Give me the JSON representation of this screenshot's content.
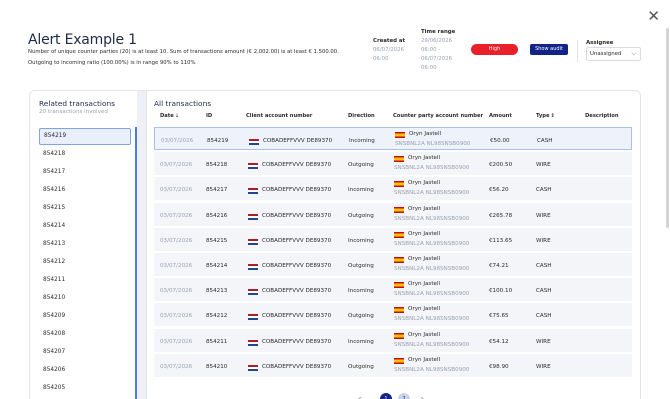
{
  "header": {
    "title": "Alert Example 1",
    "description_line1": "Number of unique counter parties (20) is at least 10. Sum of transactions amount (€ 2,002.00) is at least € 1.500.00.",
    "description_line2": "Outgoing to incoming ratio (100.00%) is in range 90% to 110%",
    "created_label": "Created at",
    "created_value": "06/07/2026 06:00",
    "range_label": "Time range",
    "range_value": "29/06/2026 06:00 - 06/07/2026 06:00",
    "severity": "High",
    "show_audit_label": "Show audit",
    "assignee_label": "Assignee",
    "assignee_value": "Unassigned"
  },
  "related": {
    "title": "Related transactions",
    "subtitle": "20 transactions involved",
    "items": [
      "854219",
      "854218",
      "854217",
      "854216",
      "854215",
      "854214",
      "854213",
      "854212",
      "854211",
      "854210",
      "854209",
      "854208",
      "854207",
      "854206",
      "854205"
    ]
  },
  "table": {
    "title": "All transactions",
    "columns": {
      "date": "Date",
      "id": "ID",
      "client": "Client account number",
      "direction": "Direction",
      "counterparty": "Counter party account number",
      "amount": "Amount",
      "type": "Type",
      "description": "Description"
    },
    "rows": [
      {
        "date": "03/07/2026",
        "id": "854219",
        "client": "COBADEFFVVV DE89370",
        "direction": "Incoming",
        "cp_name": "Oryn Jastell",
        "cp_acct": "SNSBNL2A NL98SNSB0900",
        "amount": "€50.00",
        "type": "CASH"
      },
      {
        "date": "03/07/2026",
        "id": "854218",
        "client": "COBADEFFVVV DE89370",
        "direction": "Outgoing",
        "cp_name": "Oryn Jastell",
        "cp_acct": "SNSBNL2A NL98SNSB0900",
        "amount": "€200.50",
        "type": "WIRE"
      },
      {
        "date": "03/07/2026",
        "id": "854217",
        "client": "COBADEFFVVV DE89370",
        "direction": "Incoming",
        "cp_name": "Oryn Jastell",
        "cp_acct": "SNSBNL2A NL98SNSB0900",
        "amount": "€56.20",
        "type": "CASH"
      },
      {
        "date": "03/07/2026",
        "id": "854216",
        "client": "COBADEFFVVV DE89370",
        "direction": "Outgoing",
        "cp_name": "Oryn Jastell",
        "cp_acct": "SNSBNL2A NL98SNSB0900",
        "amount": "€265.78",
        "type": "WIRE"
      },
      {
        "date": "03/07/2026",
        "id": "854215",
        "client": "COBADEFFVVV DE89370",
        "direction": "Incoming",
        "cp_name": "Oryn Jastell",
        "cp_acct": "SNSBNL2A NL98SNSB0900",
        "amount": "€113.65",
        "type": "WIRE"
      },
      {
        "date": "03/07/2026",
        "id": "854214",
        "client": "COBADEFFVVV DE89370",
        "direction": "Outgoing",
        "cp_name": "Oryn Jastell",
        "cp_acct": "SNSBNL2A NL98SNSB0900",
        "amount": "€74.21",
        "type": "CASH"
      },
      {
        "date": "03/07/2026",
        "id": "854213",
        "client": "COBADEFFVVV DE89370",
        "direction": "Incoming",
        "cp_name": "Oryn Jastell",
        "cp_acct": "SNSBNL2A NL98SNSB0900",
        "amount": "€100.10",
        "type": "CASH"
      },
      {
        "date": "03/07/2026",
        "id": "854212",
        "client": "COBADEFFVVV DE89370",
        "direction": "Outgoing",
        "cp_name": "Oryn Jastell",
        "cp_acct": "SNSBNL2A NL98SNSB0900",
        "amount": "€75.65",
        "type": "CASH"
      },
      {
        "date": "03/07/2026",
        "id": "854211",
        "client": "COBADEFFVVV DE89370",
        "direction": "Incoming",
        "cp_name": "Oryn Jastell",
        "cp_acct": "SNSBNL2A NL98SNSB0900",
        "amount": "€54.12",
        "type": "WIRE"
      },
      {
        "date": "03/07/2026",
        "id": "854210",
        "client": "COBADEFFVVV DE89370",
        "direction": "Outgoing",
        "cp_name": "Oryn Jastell",
        "cp_acct": "SNSBNL2A NL98SNSB0900",
        "amount": "€98.90",
        "type": "WIRE"
      }
    ]
  },
  "pagination": {
    "prev": "<",
    "page1": "1",
    "page2": "2",
    "next": ">"
  },
  "icons": {
    "close": "close-icon",
    "sort": "sort-icon",
    "chevron": "chevron-down-icon"
  },
  "colors": {
    "severity_high": "#e8202a",
    "primary": "#12238a"
  }
}
